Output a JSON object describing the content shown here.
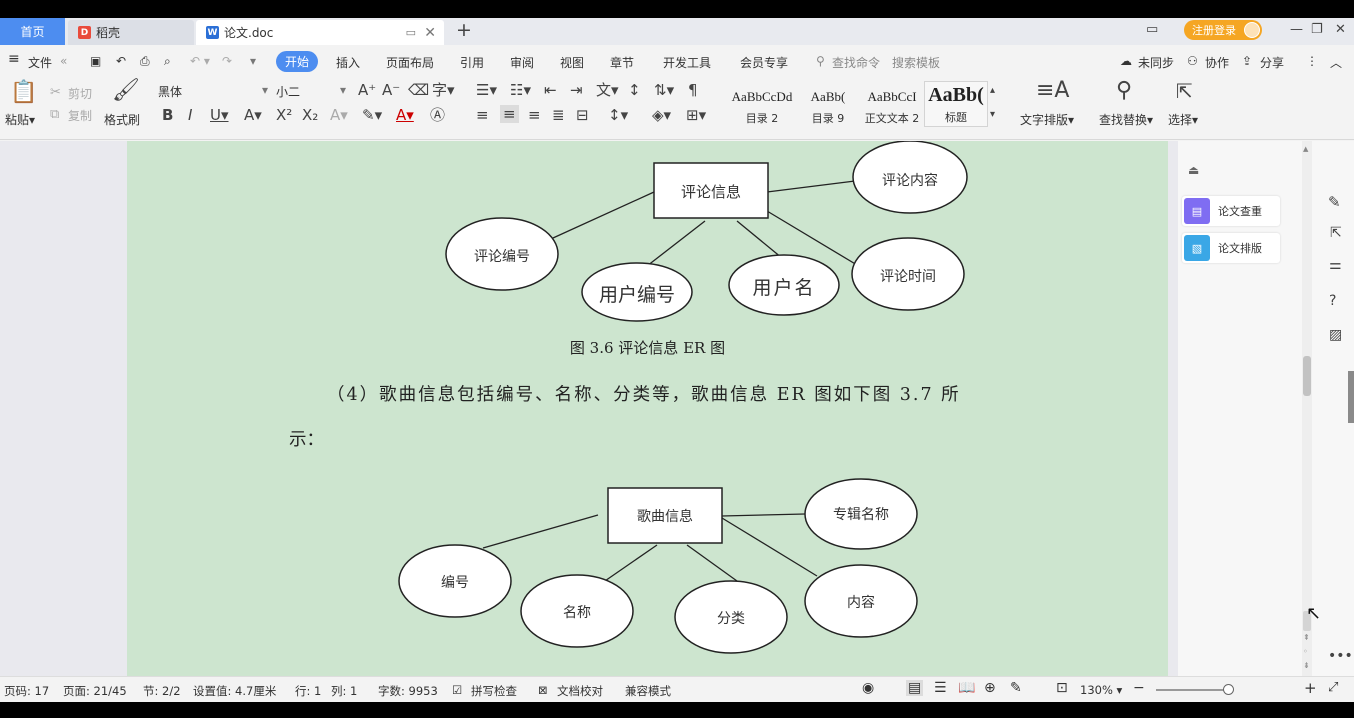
{
  "tabs": {
    "home": "首页",
    "draft": "稻壳",
    "doc": "论文.doc",
    "login": "注册登录"
  },
  "menu": {
    "file": "文件",
    "items": [
      "开始",
      "插入",
      "页面布局",
      "引用",
      "审阅",
      "视图",
      "章节",
      "开发工具",
      "会员专享"
    ],
    "search": "查找命令",
    "search2": "搜索模板",
    "sync": "未同步",
    "collab": "协作",
    "share": "分享"
  },
  "ribbon": {
    "paste": "粘贴",
    "cut": "剪切",
    "copy": "复制",
    "format_painter": "格式刷",
    "font_name": "黑体",
    "font_size": "小二",
    "styles": [
      {
        "preview": "AaBbCcDd",
        "name": "目录 2"
      },
      {
        "preview": "AaBb(",
        "name": "目录 9"
      },
      {
        "preview": "AaBbCcI",
        "name": "正文文本 2"
      },
      {
        "preview": "AaBb(",
        "name": "标题"
      }
    ],
    "text_layout": "文字排版",
    "find_replace": "查找替换",
    "select": "选择"
  },
  "document": {
    "fig1": {
      "center": "评论信息",
      "attrs": [
        "评论内容",
        "评论编号",
        "用户编号",
        "用户名",
        "评论时间"
      ],
      "caption": "图 3.6 评论信息 ER 图"
    },
    "paragraph": "（4）歌曲信息包括编号、名称、分类等，歌曲信息 ER 图如下图 3.7 所",
    "paragraph_cont": "示：",
    "fig2": {
      "center": "歌曲信息",
      "attrs": [
        "专辑名称",
        "编号",
        "名称",
        "分类",
        "内容"
      ]
    }
  },
  "right_panel": {
    "check": "论文查重",
    "layout": "论文排版"
  },
  "status": {
    "page_code": "页码: 17",
    "page": "页面: 21/45",
    "section": "节: 2/2",
    "setting": "设置值: 4.7厘米",
    "row": "行: 1",
    "col": "列: 1",
    "words": "字数: 9953",
    "spell": "拼写检查",
    "proof": "文档校对",
    "compat": "兼容模式",
    "zoom": "130%"
  },
  "colors": {
    "accent": "#4d8df0",
    "page_bg": "#cde5cf",
    "login": "#f5a623"
  }
}
